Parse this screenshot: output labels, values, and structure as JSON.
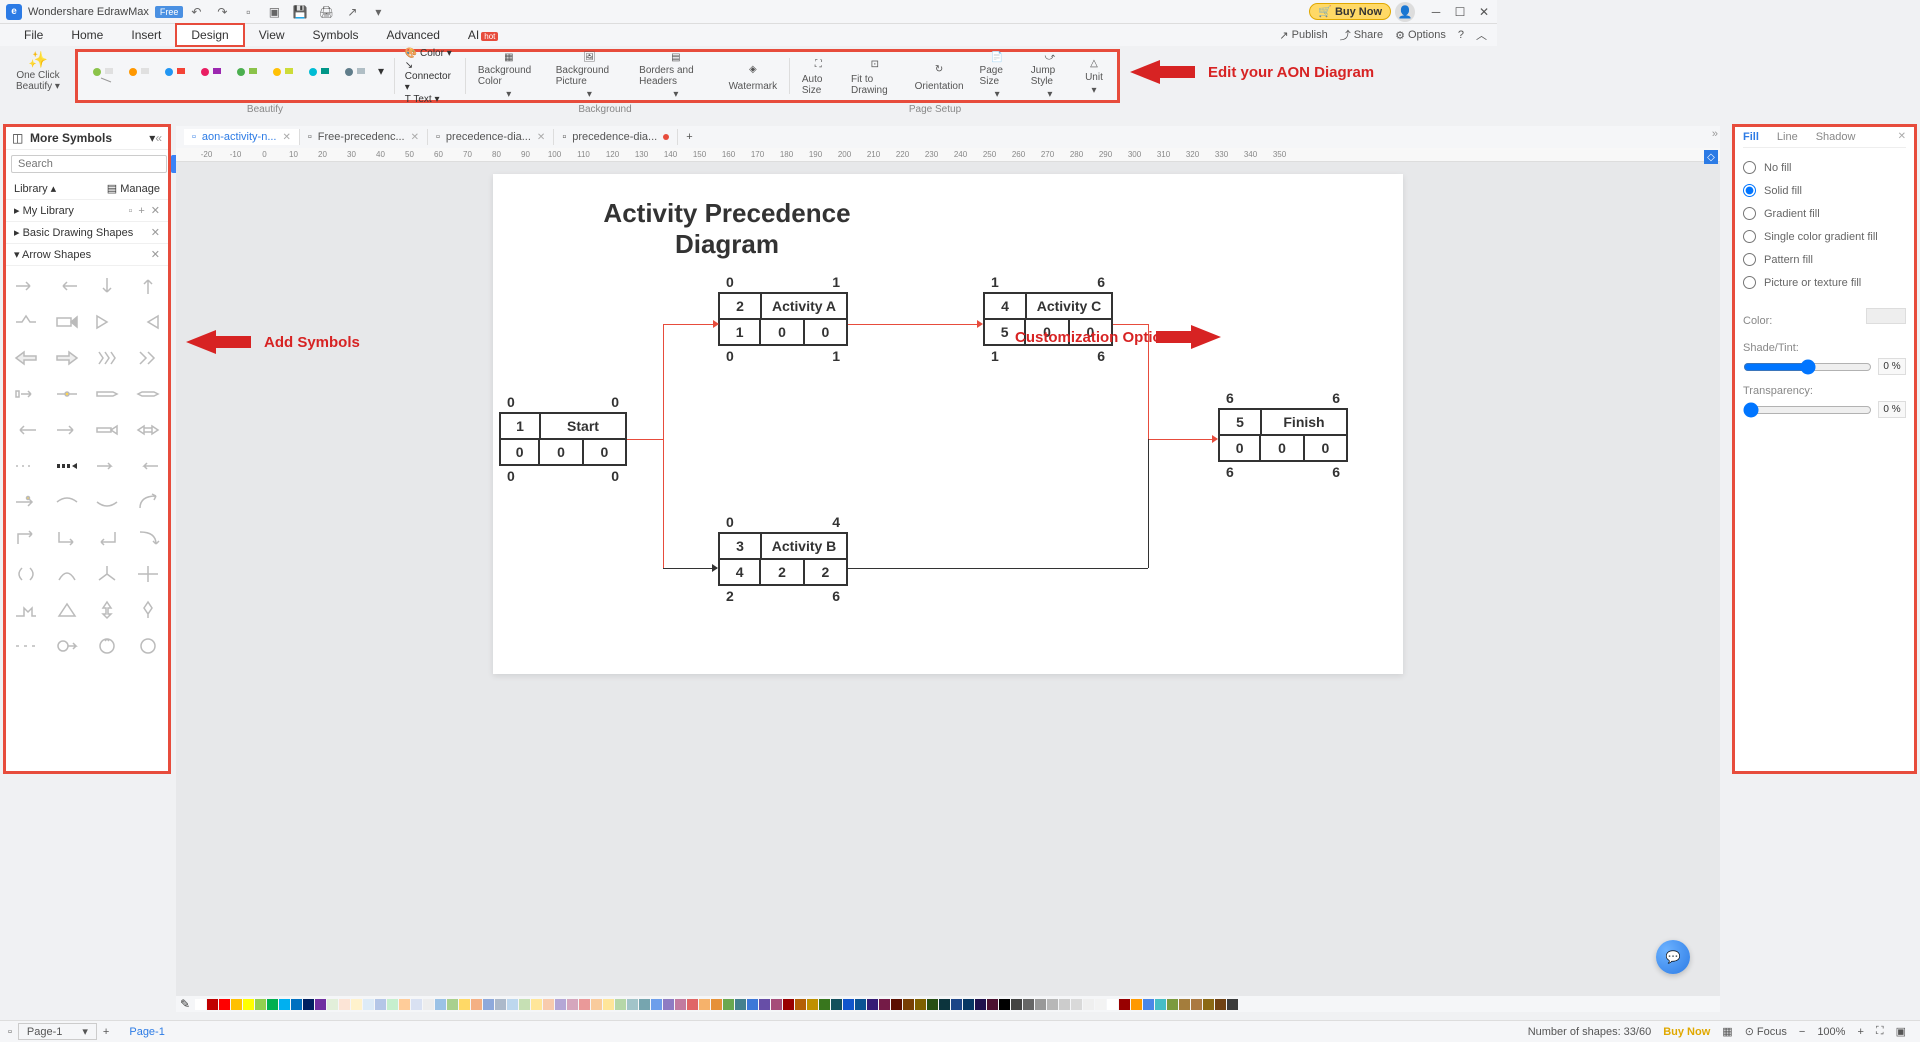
{
  "app": {
    "name": "Wondershare EdrawMax",
    "badge": "Free"
  },
  "titlebar": {
    "buy": "Buy Now"
  },
  "menu": {
    "items": [
      "File",
      "Home",
      "Insert",
      "Design",
      "View",
      "Symbols",
      "Advanced",
      "AI"
    ],
    "active": "Design",
    "right": {
      "publish": "Publish",
      "share": "Share",
      "options": "Options"
    }
  },
  "oneclick": {
    "label1": "One Click",
    "label2": "Beautify"
  },
  "ribbon": {
    "color": "Color",
    "connector": "Connector",
    "text": "Text",
    "bgcolor": "Background Color",
    "bgpicture": "Background Picture",
    "borders": "Borders and Headers",
    "watermark": "Watermark",
    "autosize": "Auto Size",
    "fit": "Fit to Drawing",
    "orientation": "Orientation",
    "pagesize": "Page Size",
    "jumpstyle": "Jump Style",
    "unit": "Unit",
    "sections": {
      "beautify": "Beautify",
      "background": "Background",
      "pagesetup": "Page Setup"
    }
  },
  "annotations": {
    "editDiagram": "Edit your AON Diagram",
    "addSymbols": "Add Symbols",
    "customization": "Customization Options"
  },
  "leftPanel": {
    "title": "More Symbols",
    "searchPlaceholder": "Search",
    "searchBtn": "Search",
    "library": "Library",
    "manage": "Manage",
    "myLibrary": "My Library",
    "basic": "Basic Drawing Shapes",
    "arrow": "Arrow Shapes"
  },
  "tabs": [
    {
      "name": "aon-activity-n...",
      "active": true
    },
    {
      "name": "Free-precedenc..."
    },
    {
      "name": "precedence-dia..."
    },
    {
      "name": "precedence-dia...",
      "modified": true
    }
  ],
  "rulerMarks": [
    "-20",
    "-10",
    "0",
    "10",
    "20",
    "30",
    "40",
    "50",
    "60",
    "70",
    "80",
    "90",
    "100",
    "110",
    "120",
    "130",
    "140",
    "150",
    "160",
    "170",
    "180",
    "190",
    "200",
    "210",
    "220",
    "230",
    "240",
    "250",
    "260",
    "270",
    "280",
    "290",
    "300",
    "310",
    "320",
    "330",
    "340",
    "350"
  ],
  "diagram": {
    "title": "Activity Precedence Diagram",
    "start": {
      "top": [
        "0",
        "0"
      ],
      "r1": [
        "1",
        "Start"
      ],
      "r2": [
        "0",
        "0",
        "0"
      ],
      "bot": [
        "0",
        "0"
      ]
    },
    "a": {
      "top": [
        "0",
        "1"
      ],
      "r1": [
        "2",
        "Activity A"
      ],
      "r2": [
        "1",
        "0",
        "0"
      ],
      "bot": [
        "0",
        "1"
      ]
    },
    "b": {
      "top": [
        "0",
        "4"
      ],
      "r1": [
        "3",
        "Activity B"
      ],
      "r2": [
        "4",
        "2",
        "2"
      ],
      "bot": [
        "2",
        "6"
      ]
    },
    "c": {
      "top": [
        "1",
        "6"
      ],
      "r1": [
        "4",
        "Activity C"
      ],
      "r2": [
        "5",
        "0",
        "0"
      ],
      "bot": [
        "1",
        "6"
      ]
    },
    "finish": {
      "top": [
        "6",
        "6"
      ],
      "r1": [
        "5",
        "Finish"
      ],
      "r2": [
        "0",
        "0",
        "0"
      ],
      "bot": [
        "6",
        "6"
      ]
    }
  },
  "rightPanel": {
    "tabs": [
      "Fill",
      "Line",
      "Shadow"
    ],
    "opts": [
      "No fill",
      "Solid fill",
      "Gradient fill",
      "Single color gradient fill",
      "Pattern fill",
      "Picture or texture fill"
    ],
    "color": "Color:",
    "shade": "Shade/Tint:",
    "transparency": "Transparency:",
    "shadeVal": "0 %",
    "transVal": "0 %"
  },
  "statusbar": {
    "page": "Page-1",
    "pageTab": "Page-1",
    "shapes": "Number of shapes: 33/60",
    "buy": "Buy Now",
    "focus": "Focus",
    "zoom": "100%"
  },
  "colorSwatches": [
    "#ffffff",
    "#c00000",
    "#ff0000",
    "#ffc000",
    "#ffff00",
    "#92d050",
    "#00b050",
    "#00b0f0",
    "#0070c0",
    "#002060",
    "#7030a0",
    "#e2efda",
    "#fce4d6",
    "#fff2cc",
    "#ddebf7",
    "#b4c6e7",
    "#c6efce",
    "#ffcc99",
    "#d9e1f2",
    "#ededed",
    "#9bc2e6",
    "#a9d08e",
    "#ffd966",
    "#f4b084",
    "#8ea9db",
    "#acb9ca",
    "#bdd7ee",
    "#c6e0b4",
    "#ffe699",
    "#f8cbad",
    "#b4a7d6",
    "#d5a6bd",
    "#ea9999",
    "#f9cb9c",
    "#ffe599",
    "#b6d7a8",
    "#a2c4c9",
    "#76a5af",
    "#6d9eeb",
    "#8e7cc3",
    "#c27ba0",
    "#e06666",
    "#f6b26b",
    "#e69138",
    "#6aa84f",
    "#45818e",
    "#3c78d8",
    "#674ea7",
    "#a64d79",
    "#990000",
    "#b45f06",
    "#bf9000",
    "#38761d",
    "#134f5c",
    "#1155cc",
    "#0b5394",
    "#351c75",
    "#741b47",
    "#5b0f00",
    "#783f04",
    "#7f6000",
    "#274e13",
    "#0c343d",
    "#1c4587",
    "#073763",
    "#20124d",
    "#4c1130",
    "#000000",
    "#434343",
    "#666666",
    "#999999",
    "#b7b7b7",
    "#cccccc",
    "#d9d9d9",
    "#efefef",
    "#f3f3f3",
    "#ffffff",
    "#980000",
    "#ff9900",
    "#4a86e8",
    "#46bdc6",
    "#7b9a3f",
    "#a47d3c",
    "#ab7942",
    "#8b6914",
    "#704214",
    "#3b3b3b"
  ]
}
